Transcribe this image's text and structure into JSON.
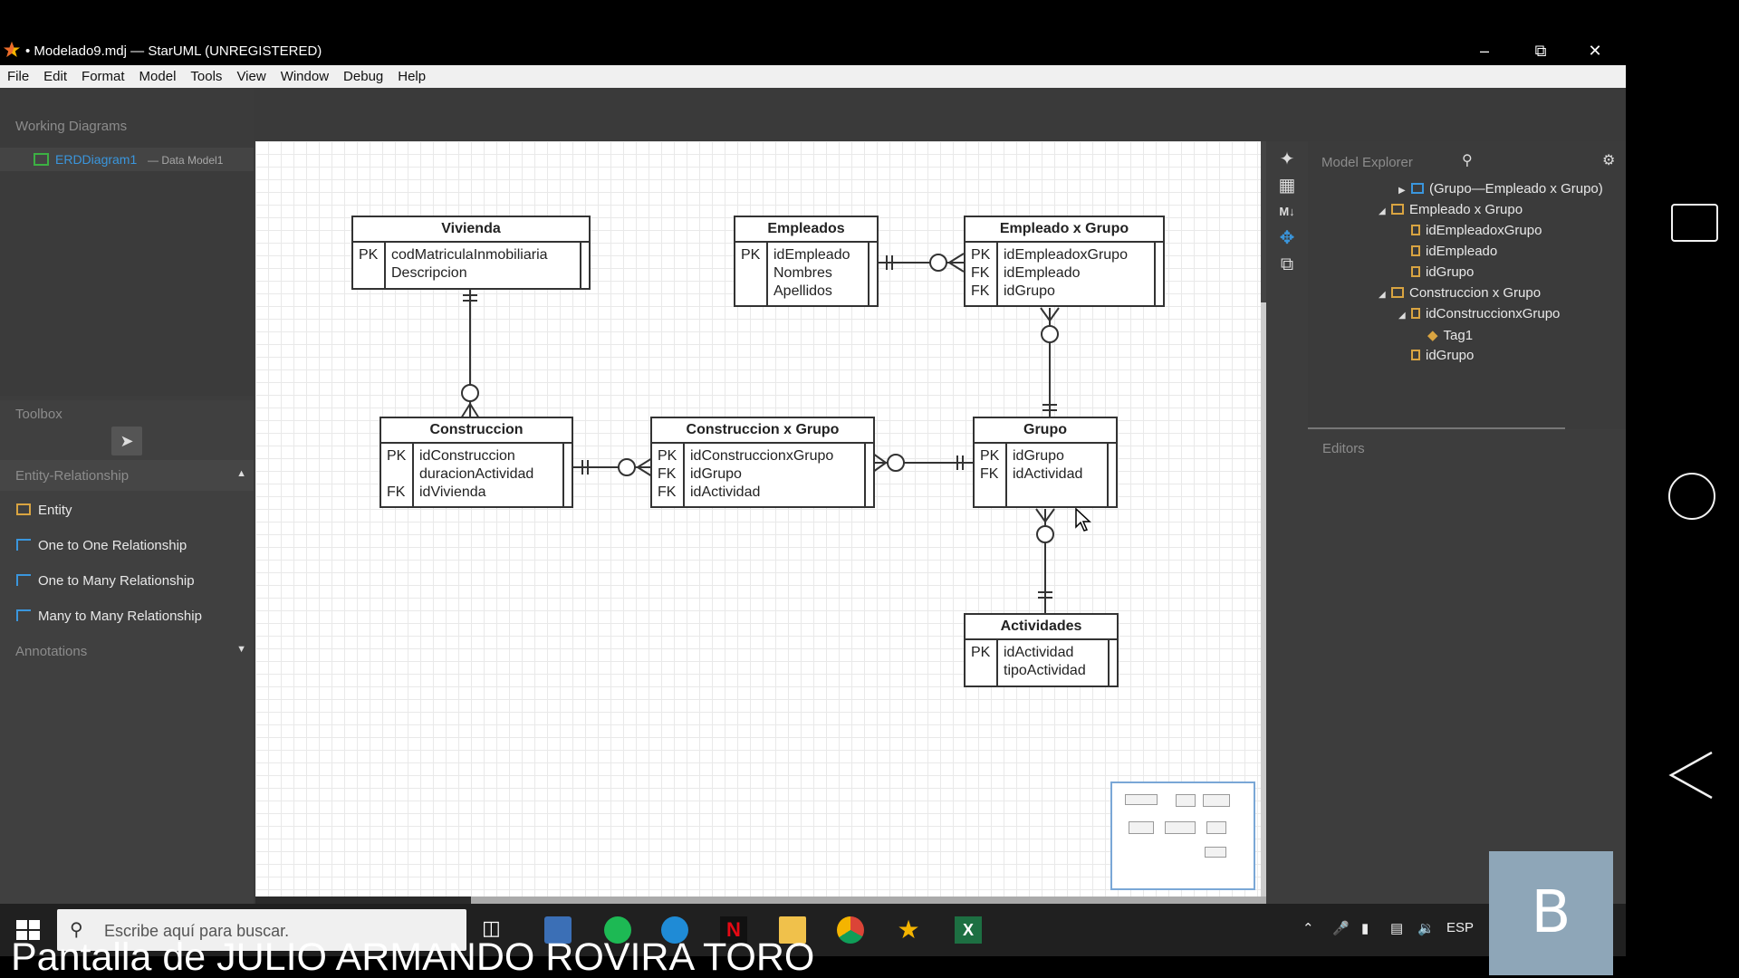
{
  "window": {
    "title": "• Modelado9.mdj — StarUML (UNREGISTERED)",
    "controls": [
      "minimize",
      "restore",
      "close"
    ]
  },
  "menu": [
    "File",
    "Edit",
    "Format",
    "Model",
    "Tools",
    "View",
    "Window",
    "Debug",
    "Help"
  ],
  "working_diagrams": {
    "header": "Working Diagrams",
    "item_name": "ERDDiagram1",
    "item_sub": "— Data Model1"
  },
  "toolbox": {
    "header": "Toolbox",
    "group": "Entity-Relationship",
    "tools": [
      "Entity",
      "One to One Relationship",
      "One to Many Relationship",
      "Many to Many Relationship"
    ],
    "annotations": "Annotations"
  },
  "entities": {
    "vivienda": {
      "title": "Vivienda",
      "keys": "PK",
      "cols": [
        "codMatriculaInmobiliaria",
        "Descripcion"
      ]
    },
    "empleados": {
      "title": "Empleados",
      "keys": "PK",
      "cols": [
        "idEmpleado",
        "Nombres",
        "Apellidos"
      ]
    },
    "empleado_grupo": {
      "title": "Empleado x Grupo",
      "keys": [
        "PK",
        "FK",
        "FK"
      ],
      "cols": [
        "idEmpleadoxGrupo",
        "idEmpleado",
        "idGrupo"
      ]
    },
    "construccion": {
      "title": "Construccion",
      "keys": [
        "PK",
        "",
        "FK"
      ],
      "cols": [
        "idConstruccion",
        "duracionActividad",
        "idVivienda"
      ]
    },
    "construccion_grupo": {
      "title": "Construccion x Grupo",
      "keys": [
        "PK",
        "FK",
        "FK"
      ],
      "cols": [
        "idConstruccionxGrupo",
        "idGrupo",
        "idActividad"
      ]
    },
    "grupo": {
      "title": "Grupo",
      "keys": [
        "PK",
        "FK"
      ],
      "cols": [
        "idGrupo",
        "idActividad"
      ]
    },
    "actividades": {
      "title": "Actividades",
      "keys": "PK",
      "cols": [
        "idActividad",
        "tipoActividad"
      ]
    }
  },
  "model_explorer": {
    "header": "Model Explorer",
    "items": [
      "(Grupo—Empleado x Grupo)",
      "Empleado x Grupo",
      "idEmpleadoxGrupo",
      "idEmpleado",
      "idGrupo",
      "Construccion x Grupo",
      "idConstruccionxGrupo",
      "Tag1",
      "idGrupo"
    ]
  },
  "editors": {
    "header": "Editors"
  },
  "taskbar": {
    "search_placeholder": "Escribe aquí para buscar.",
    "lang": "ESP"
  },
  "caption": "Pantalla de JULIO ARMANDO ROVIRA TORO",
  "badge": "B",
  "colors": {
    "accent": "#3a96dd",
    "entity_icon": "#d9a441",
    "diagram_icon": "#3cb043"
  }
}
